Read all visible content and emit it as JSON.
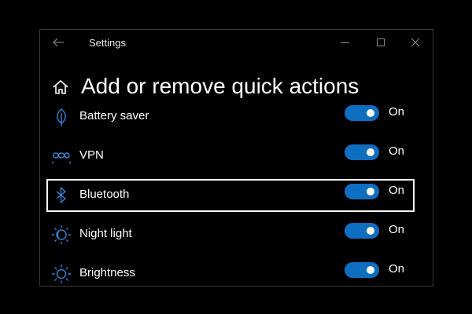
{
  "window": {
    "title": "Settings"
  },
  "page": {
    "title": "Add or remove quick actions"
  },
  "colors": {
    "accent": "#0e6ec2",
    "icon": "#2f84d6",
    "background": "#000000"
  },
  "quick_actions": [
    {
      "label": "Battery saver",
      "icon": "leaf-icon",
      "state": "On",
      "on": true
    },
    {
      "label": "VPN",
      "icon": "vpn-icon",
      "state": "On",
      "on": true
    },
    {
      "label": "Bluetooth",
      "icon": "bluetooth-icon",
      "state": "On",
      "on": true,
      "focused": true
    },
    {
      "label": "Night light",
      "icon": "night-light-icon",
      "state": "On",
      "on": true
    },
    {
      "label": "Brightness",
      "icon": "brightness-icon",
      "state": "On",
      "on": true
    }
  ]
}
